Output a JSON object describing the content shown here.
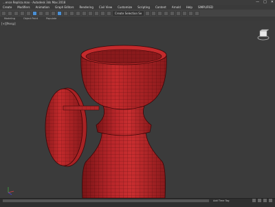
{
  "window": {
    "title": "...ence Replica.max - Autodesk 3ds Max 2018",
    "min": "—",
    "max": "□",
    "close": "✕"
  },
  "menu": [
    "Create",
    "Modifiers",
    "Animation",
    "Graph Editors",
    "Rendering",
    "Civil View",
    "Customize",
    "Scripting",
    "Content",
    "Arnold",
    "Help",
    "SIMPLIFIED"
  ],
  "toolbar": {
    "selection_set": "Create Selection Se"
  },
  "ribbon": [
    "Modeling",
    "Object Paint",
    "Populate"
  ],
  "viewport": {
    "label": "[+][Persp]",
    "colors": {
      "mesh": "#c0282a",
      "mesh_dark": "#7a1416",
      "wire": "#3a0607",
      "bg": "#3b3b3b"
    }
  },
  "status": {
    "add_time_tag": "Add Time Tag"
  }
}
